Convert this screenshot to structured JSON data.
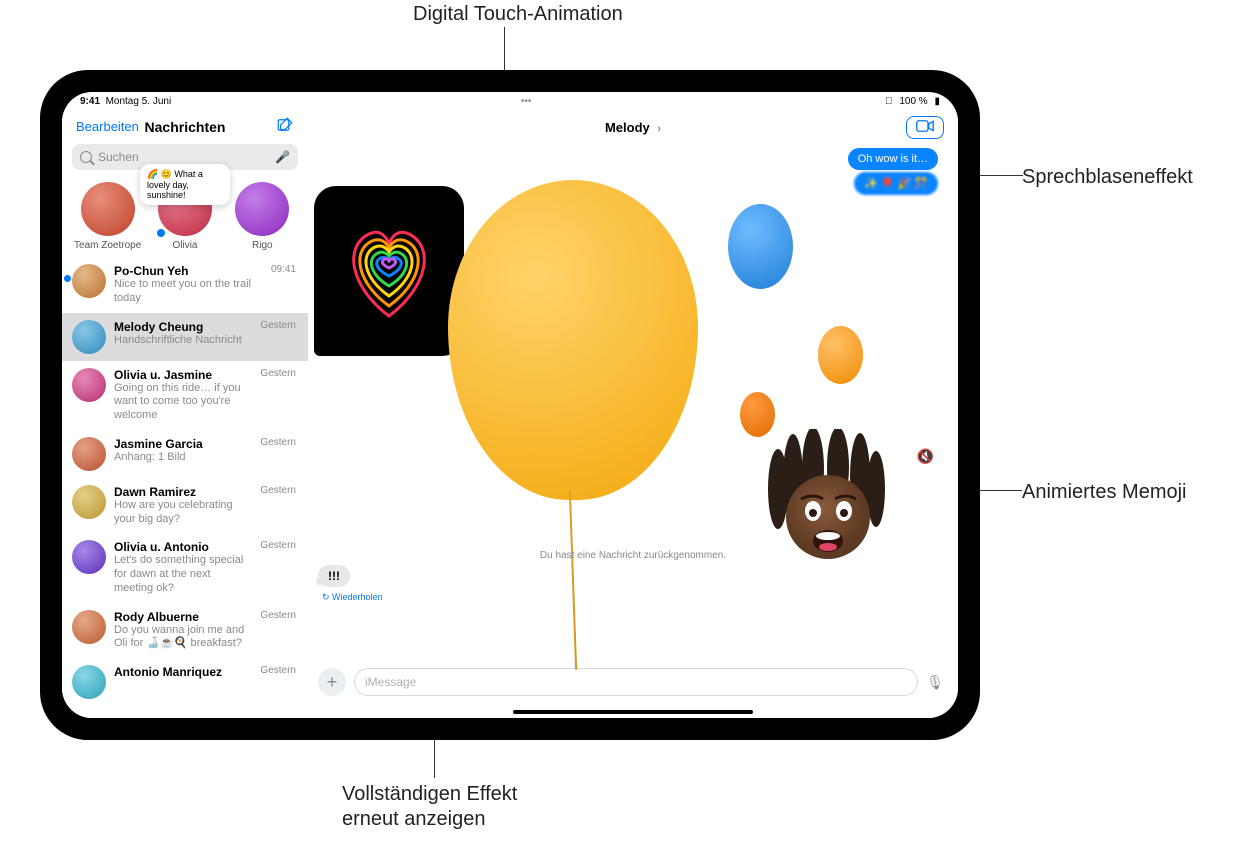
{
  "callouts": {
    "digital_touch": "Digital Touch-Animation",
    "speech_bubble": "Sprechblaseneffekt",
    "memoji": "Animiertes Memoji",
    "replay": "Vollständigen Effekt\nerneut anzeigen"
  },
  "statusbar": {
    "time": "9:41",
    "date": "Montag 5. Juni",
    "battery": "100 %",
    "wifi": "wifi",
    "batt_icon": "battery"
  },
  "sidebar": {
    "edit": "Bearbeiten",
    "title": "Nachrichten",
    "search_placeholder": "Suchen",
    "pins": [
      {
        "name": "Team Zoetrope",
        "hue": 10
      },
      {
        "name": "Olivia",
        "hue": 350,
        "tooltip": "🌈 😊 What a lovely day, sunshine!"
      },
      {
        "name": "Rigo",
        "hue": 280
      }
    ],
    "conversations": [
      {
        "name": "Po-Chun Yeh",
        "preview": "Nice to meet you on the trail today",
        "time": "09:41",
        "unread": true,
        "hue": 30
      },
      {
        "name": "Melody Cheung",
        "preview": "Handschriftliche Nachricht",
        "time": "Gestern",
        "selected": true,
        "hue": 200
      },
      {
        "name": "Olivia u. Jasmine",
        "preview": "Going on this ride… if you want to come too you're welcome",
        "time": "Gestern",
        "hue": 330
      },
      {
        "name": "Jasmine Garcia",
        "preview": "Anhang: 1 Bild",
        "time": "Gestern",
        "hue": 15
      },
      {
        "name": "Dawn Ramirez",
        "preview": "How are you celebrating your big day?",
        "time": "Gestern",
        "hue": 45
      },
      {
        "name": "Olivia u. Antonio",
        "preview": "Let's do something special for dawn at the next meeting ok?",
        "time": "Gestern",
        "hue": 260
      },
      {
        "name": "Rody Albuerne",
        "preview": "Do you wanna join me and Oli for 🍶☕🍳 breakfast?",
        "time": "Gestern",
        "hue": 20
      },
      {
        "name": "Antonio Manriquez",
        "preview": "",
        "time": "Gestern",
        "hue": 190
      }
    ]
  },
  "chat": {
    "title": "Melody",
    "msg1": "Oh wow is it…",
    "msg2": "✨ 🎈 🎉 🎊",
    "undone": "Du hast eine Nachricht zurückgenommen.",
    "exclaim": "!!!",
    "replay": "↻ Wiederholen",
    "imessage_placeholder": "iMessage"
  }
}
